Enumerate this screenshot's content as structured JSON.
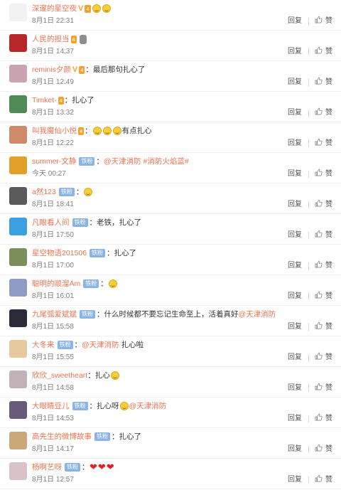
{
  "comments": [
    {
      "user": "深邃的星空夜",
      "verified": "V",
      "level": "4",
      "badge": "",
      "segments": [
        {
          "t": "emoji"
        },
        {
          "t": "emoji"
        }
      ],
      "time": "8月1日 22:31",
      "reply": "回复",
      "like": "赞",
      "avatar_color": "#f2f2f2"
    },
    {
      "user": "人民的担当",
      "verified": "",
      "level": "4",
      "badge": "",
      "segments": [
        {
          "t": "mic"
        }
      ],
      "time": "8月1日 14:37",
      "reply": "回复",
      "like": "赞",
      "avatar_color": "#b8262a"
    },
    {
      "user": "reminis夕颜",
      "verified": "V",
      "level": "4",
      "badge": "",
      "segments": [
        {
          "t": "text",
          "v": "：最后那句扎心了"
        }
      ],
      "time": "8月1日 12:49",
      "reply": "回复",
      "like": "赞",
      "avatar_color": "#c9a3b0"
    },
    {
      "user": "Timket-",
      "verified": "",
      "level": "4",
      "badge": "",
      "segments": [
        {
          "t": "text",
          "v": "：扎心了"
        }
      ],
      "time": "8月1日 13:32",
      "reply": "回复",
      "like": "赞",
      "avatar_color": "#4f8a56"
    },
    {
      "user": "叫我魔仙小悦",
      "verified": "",
      "level": "4",
      "badge": "",
      "segments": [
        {
          "t": "text",
          "v": "："
        },
        {
          "t": "emoji"
        },
        {
          "t": "emoji"
        },
        {
          "t": "emoji"
        },
        {
          "t": "text",
          "v": "有点扎心"
        }
      ],
      "time": "8月1日 12:22",
      "reply": "回复",
      "like": "赞",
      "avatar_color": "#d08a6a"
    },
    {
      "user": "summer-文静",
      "verified": "",
      "level": "",
      "badge": "铁粉",
      "segments": [
        {
          "t": "text",
          "v": "："
        },
        {
          "t": "mention",
          "v": "@天津消防"
        },
        {
          "t": "text",
          "v": " "
        },
        {
          "t": "mention",
          "v": "#消防火焰蓝#"
        }
      ],
      "time": "今天 00:27",
      "reply": "回复",
      "like": "赞",
      "avatar_color": "#e0a02a"
    },
    {
      "user": "a然123",
      "verified": "",
      "level": "",
      "badge": "铁粉",
      "segments": [
        {
          "t": "text",
          "v": "："
        },
        {
          "t": "emoji"
        }
      ],
      "time": "8月1日 18:41",
      "reply": "回复",
      "like": "赞",
      "avatar_color": "#5a5a5a"
    },
    {
      "user": "凡眼看人间",
      "verified": "",
      "level": "",
      "badge": "铁粉",
      "segments": [
        {
          "t": "text",
          "v": "：老铁，扎心了"
        }
      ],
      "time": "8月1日 17:50",
      "reply": "回复",
      "like": "赞",
      "avatar_color": "#3aa0e0"
    },
    {
      "user": "星空物语201506",
      "verified": "",
      "level": "",
      "badge": "铁粉",
      "segments": [
        {
          "t": "text",
          "v": "：扎心了"
        }
      ],
      "time": "8月1日 17:00",
      "reply": "回复",
      "like": "赞",
      "avatar_color": "#7a8f5c"
    },
    {
      "user": "聪明的顺溜Am",
      "verified": "",
      "level": "",
      "badge": "铁粉",
      "segments": [
        {
          "t": "text",
          "v": "："
        },
        {
          "t": "emoji"
        }
      ],
      "time": "8月1日 16:01",
      "reply": "回复",
      "like": "赞",
      "avatar_color": "#8e9cc4"
    },
    {
      "user": "九尾弧爱斌斌",
      "verified": "",
      "level": "",
      "badge": "铁粉",
      "segments": [
        {
          "t": "text",
          "v": "：什么时候都不要忘记生命至上，活着真好"
        },
        {
          "t": "mention",
          "v": "@天津消防"
        }
      ],
      "time": "8月1日 15:58",
      "reply": "回复",
      "like": "赞",
      "avatar_color": "#2b2b3a"
    },
    {
      "user": "大冬来",
      "verified": "",
      "level": "",
      "badge": "铁粉",
      "segments": [
        {
          "t": "text",
          "v": "："
        },
        {
          "t": "mention",
          "v": "@天津消防"
        },
        {
          "t": "text",
          "v": " 扎心啦"
        }
      ],
      "time": "8月1日 15:55",
      "reply": "回复",
      "like": "赞",
      "avatar_color": "#e7c9a0"
    },
    {
      "user": "欣欣_sweetheart",
      "verified": "",
      "level": "",
      "badge": "",
      "segments": [
        {
          "t": "text",
          "v": "：扎心"
        },
        {
          "t": "emoji"
        }
      ],
      "time": "8月1日 14:58",
      "reply": "回复",
      "like": "赞",
      "avatar_color": "#c2b2b8"
    },
    {
      "user": "大眼睛豆儿",
      "verified": "",
      "level": "",
      "badge": "铁粉",
      "segments": [
        {
          "t": "text",
          "v": "：扎心呀"
        },
        {
          "t": "emoji"
        },
        {
          "t": "mention",
          "v": "@天津消防"
        }
      ],
      "time": "8月1日 14:53",
      "reply": "回复",
      "like": "赞",
      "avatar_color": "#6a5a7a"
    },
    {
      "user": "高先生的微博故事",
      "verified": "",
      "level": "",
      "badge": "铁粉",
      "segments": [
        {
          "t": "text",
          "v": "：扎心了"
        }
      ],
      "time": "8月1日 14:17",
      "reply": "回复",
      "like": "赞",
      "avatar_color": "#caa878"
    },
    {
      "user": "杨啊艺呀",
      "verified": "",
      "level": "",
      "badge": "铁粉",
      "segments": [
        {
          "t": "text",
          "v": "："
        },
        {
          "t": "heart"
        },
        {
          "t": "heart"
        },
        {
          "t": "heart"
        }
      ],
      "time": "8月1日 12:57",
      "reply": "回复",
      "like": "赞",
      "avatar_color": "#d9c3c9"
    }
  ]
}
